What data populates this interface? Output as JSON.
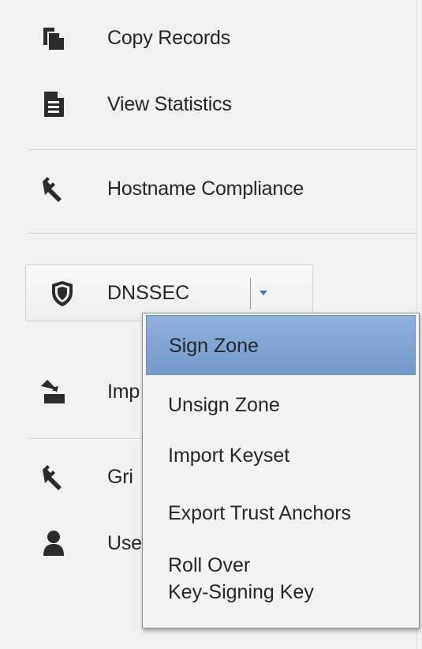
{
  "sidebar": {
    "items": [
      {
        "label": "Copy Records",
        "icon": "copy-icon"
      },
      {
        "label": "View Statistics",
        "icon": "document-icon"
      },
      {
        "label": "Hostname Compliance",
        "icon": "wrench-icon"
      },
      {
        "label": "Imp",
        "icon": "import-icon"
      },
      {
        "label": "Gri",
        "icon": "wrench-icon"
      },
      {
        "label": "Use",
        "icon": "user-icon"
      }
    ],
    "dnssec_button": {
      "label": "DNSSEC",
      "icon": "shield-icon"
    }
  },
  "dropdown_menu": {
    "items": [
      {
        "label": "Sign Zone",
        "selected": true
      },
      {
        "label": "Unsign Zone"
      },
      {
        "label": "Import Keyset"
      },
      {
        "label": "Export Trust Anchors"
      },
      {
        "label_line1": "Roll Over",
        "label_line2": "Key-Signing Key"
      }
    ]
  },
  "colors": {
    "selected_bg": "#7f a3d6",
    "caret": "#3b78c4",
    "icon": "#2b2b2b"
  }
}
